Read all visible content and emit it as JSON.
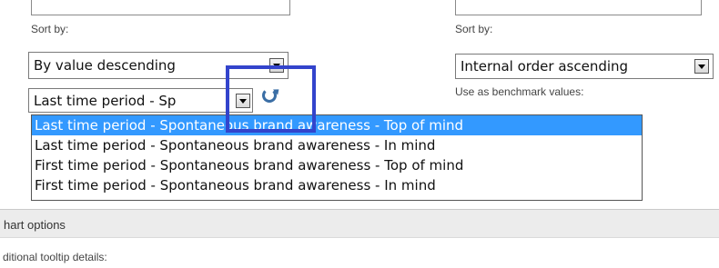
{
  "left_panel": {
    "sort_label": "Sort by:",
    "sort_select_value": "By value descending",
    "period_select_value": "Last time period - Sp"
  },
  "right_panel": {
    "sort_label": "Sort by:",
    "sort_select_value": "Internal order ascending",
    "benchmark_label": "Use as benchmark values:"
  },
  "dropdown": {
    "options": [
      "Last time period - Spontaneous brand awareness - Top of mind",
      "Last time period - Spontaneous brand awareness - In mind",
      "First time period - Spontaneous brand awareness - Top of mind",
      "First time period - Spontaneous brand awareness - In mind"
    ],
    "selected_index": 0
  },
  "chart_options": {
    "section_title": "hart options",
    "tooltip_label": "ditional tooltip details:"
  },
  "colors": {
    "selection": "#3399ff",
    "highlight_box": "#3344cc",
    "refresh_icon": "#3a6ea5"
  },
  "icons": {
    "refresh": "refresh-icon",
    "dropdown": "chevron-down-icon"
  }
}
